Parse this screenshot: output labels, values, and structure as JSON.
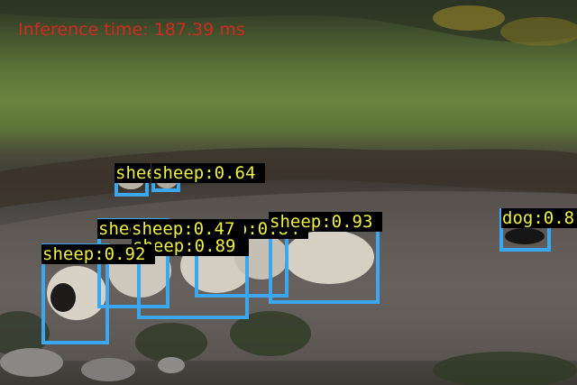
{
  "overlay": {
    "inference_text": "Inference time: 187.39 ms"
  },
  "detections": [
    {
      "label": "sheep:0.92"
    },
    {
      "label": "sheep:0.89"
    },
    {
      "label": "sheep:0.84"
    },
    {
      "label": "sheep:0.93"
    },
    {
      "label": "sheep:0.47"
    },
    {
      "label": "sheep:0.64"
    },
    {
      "label": "sheep"
    },
    {
      "label": "sheep"
    },
    {
      "label": "dog:0.8"
    }
  ],
  "colors": {
    "box": "#3aa7f0",
    "label_text": "#f0f040",
    "label_bg": "#000000",
    "timer_text": "#d12a1e"
  }
}
